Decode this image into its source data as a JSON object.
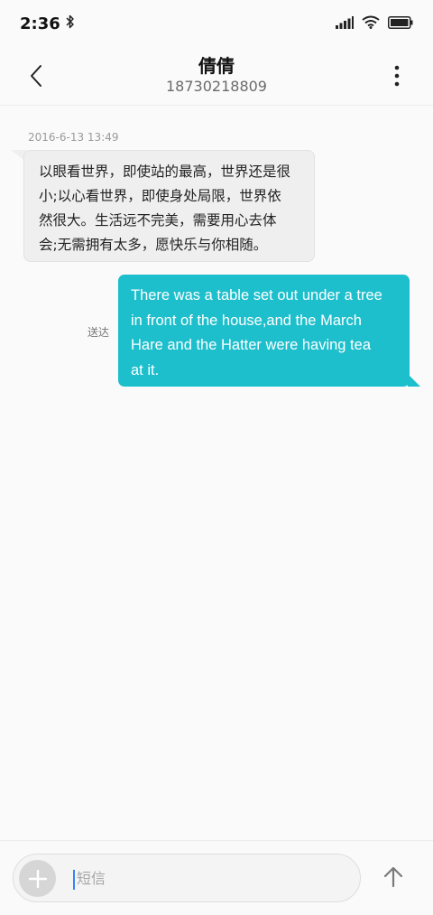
{
  "status_bar": {
    "time": "2:36",
    "icons": [
      "bluetooth-icon",
      "signal-icon",
      "wifi-icon",
      "battery-icon"
    ]
  },
  "header": {
    "contact_name": "倩倩",
    "contact_number": "18730218809",
    "back_icon": "chevron-left-icon",
    "more_icon": "more-vertical-icon"
  },
  "conversation": {
    "timestamp": "2016-6-13 13:49",
    "incoming": {
      "lines": [
        "以眼看世界，即使站的最高，世界还是很",
        "小;以心看世界，即使身处局限，世界依",
        "然很大。生活远不完美，需要用心去体",
        "会;无需拥有太多，愿快乐与你相随。"
      ]
    },
    "outgoing": {
      "status": "送达",
      "lines": [
        "There was a table set out under a tree",
        "in front of the house,and the March",
        "Hare and the Hatter were having tea",
        "at it."
      ]
    }
  },
  "composer": {
    "placeholder": "短信",
    "add_icon": "plus-icon",
    "send_icon": "arrow-up-icon"
  },
  "colors": {
    "outgoing_bubble": "#1dbfcc",
    "incoming_bubble": "#efefef",
    "cursor": "#3a82f7"
  }
}
